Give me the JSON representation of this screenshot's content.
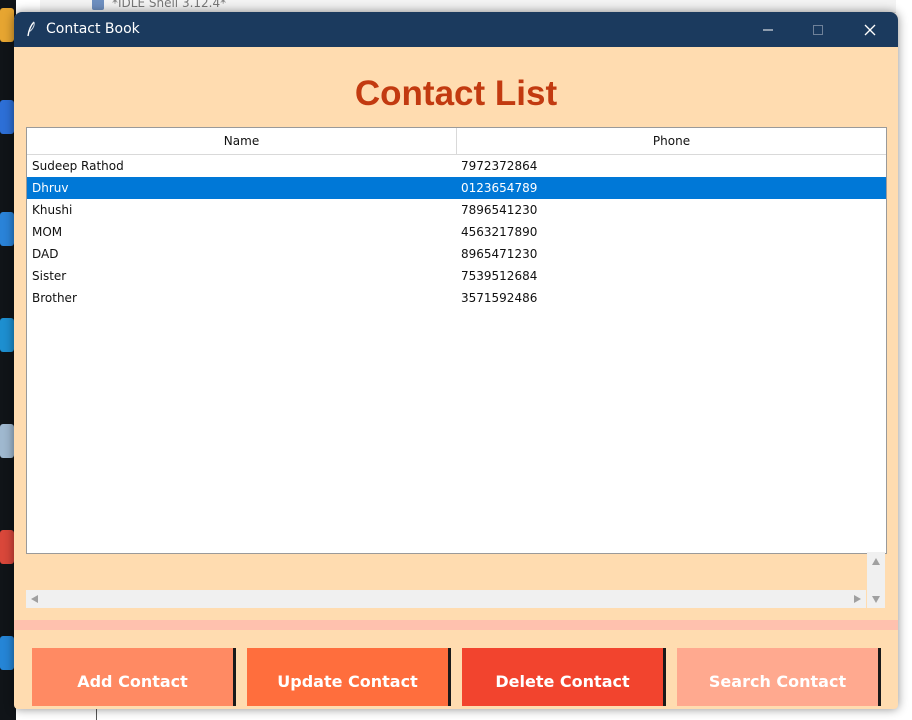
{
  "window": {
    "title": "Contact Book"
  },
  "background": {
    "window_title": "*IDLE Shell 3.12.4*"
  },
  "heading": "Contact List",
  "table": {
    "columns": [
      "Name",
      "Phone"
    ],
    "rows": [
      {
        "name": "Sudeep Rathod",
        "phone": "7972372864"
      },
      {
        "name": "Dhruv",
        "phone": "0123654789",
        "selected": true
      },
      {
        "name": "Khushi",
        "phone": "7896541230"
      },
      {
        "name": "MOM",
        "phone": "4563217890"
      },
      {
        "name": "DAD",
        "phone": "8965471230"
      },
      {
        "name": "Sister",
        "phone": "7539512684"
      },
      {
        "name": "Brother",
        "phone": "3571592486"
      }
    ]
  },
  "buttons": {
    "add": "Add Contact",
    "update": "Update Contact",
    "delete": "Delete Contact",
    "search": "Search Contact"
  },
  "colors": {
    "titlebar": "#1b3a5e",
    "window_bg": "#ffdcb0",
    "heading": "#c23a10",
    "selection": "#0078d7",
    "add_button": "#ff8a63",
    "update_button": "#ff6e3d",
    "delete_button": "#f2442e",
    "search_button": "#ffa98f"
  },
  "icons": {
    "app": "feather-icon",
    "minimize": "minimize-icon",
    "maximize": "maximize-icon",
    "close": "close-icon"
  }
}
